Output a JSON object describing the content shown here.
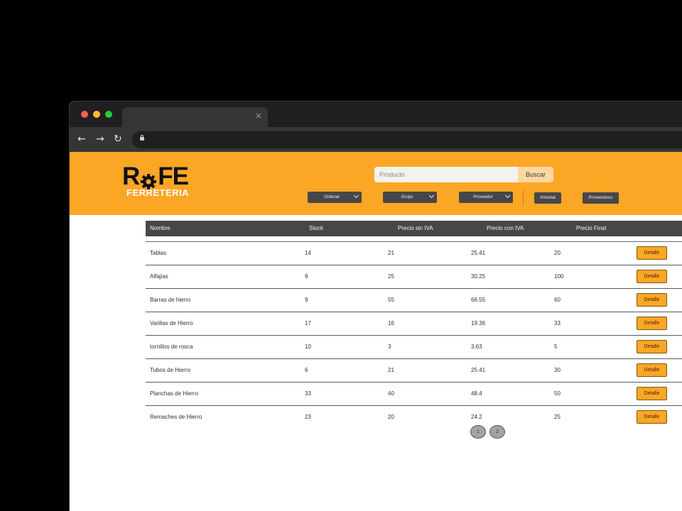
{
  "browser": {
    "tab_close": "×",
    "nav_back": "←",
    "nav_forward": "→",
    "nav_reload": "↻",
    "traffic_colors": [
      "#ff5f57",
      "#febc2e",
      "#28c840"
    ]
  },
  "header": {
    "logo_text": "RoFE",
    "logo_sub": "FERRETERIA",
    "search_placeholder": "Producto",
    "search_button": "Buscar",
    "filters": [
      {
        "label": "Ordenar"
      },
      {
        "label": "Grupo"
      },
      {
        "label": "Proveedor"
      }
    ],
    "nav_buttons": [
      {
        "label": "Historial"
      },
      {
        "label": "Proveedores"
      }
    ],
    "accent_color": "#fca626"
  },
  "table": {
    "columns": [
      "Nombre",
      "Stock",
      "Precio sin IVA",
      "Precio con IVA",
      "Precio Final"
    ],
    "rows": [
      {
        "nombre": "Tablas",
        "stock": "14",
        "sin_iva": "21",
        "con_iva": "25.41",
        "final": "20",
        "action": "Detalle"
      },
      {
        "nombre": "Alfajias",
        "stock": "9",
        "sin_iva": "25",
        "con_iva": "30.25",
        "final": "100",
        "action": "Detalle"
      },
      {
        "nombre": "Barras de hierro",
        "stock": "9",
        "sin_iva": "55",
        "con_iva": "66.55",
        "final": "60",
        "action": "Detalle"
      },
      {
        "nombre": "Varillas de Hierro",
        "stock": "17",
        "sin_iva": "16",
        "con_iva": "19.36",
        "final": "33",
        "action": "Detalle"
      },
      {
        "nombre": "tornillos de rosca",
        "stock": "10",
        "sin_iva": "3",
        "con_iva": "3.63",
        "final": "5",
        "action": "Detalle"
      },
      {
        "nombre": "Tubos de Hierro",
        "stock": "6",
        "sin_iva": "21",
        "con_iva": "25.41",
        "final": "30",
        "action": "Detalle"
      },
      {
        "nombre": "Planchas de Hierro",
        "stock": "33",
        "sin_iva": "40",
        "con_iva": "48.4",
        "final": "50",
        "action": "Detalle"
      },
      {
        "nombre": "Remaches de Hierro",
        "stock": "23",
        "sin_iva": "20",
        "con_iva": "24.2",
        "final": "25",
        "action": "Detalle"
      }
    ]
  },
  "pagination": {
    "pages": [
      "1",
      "2"
    ]
  }
}
